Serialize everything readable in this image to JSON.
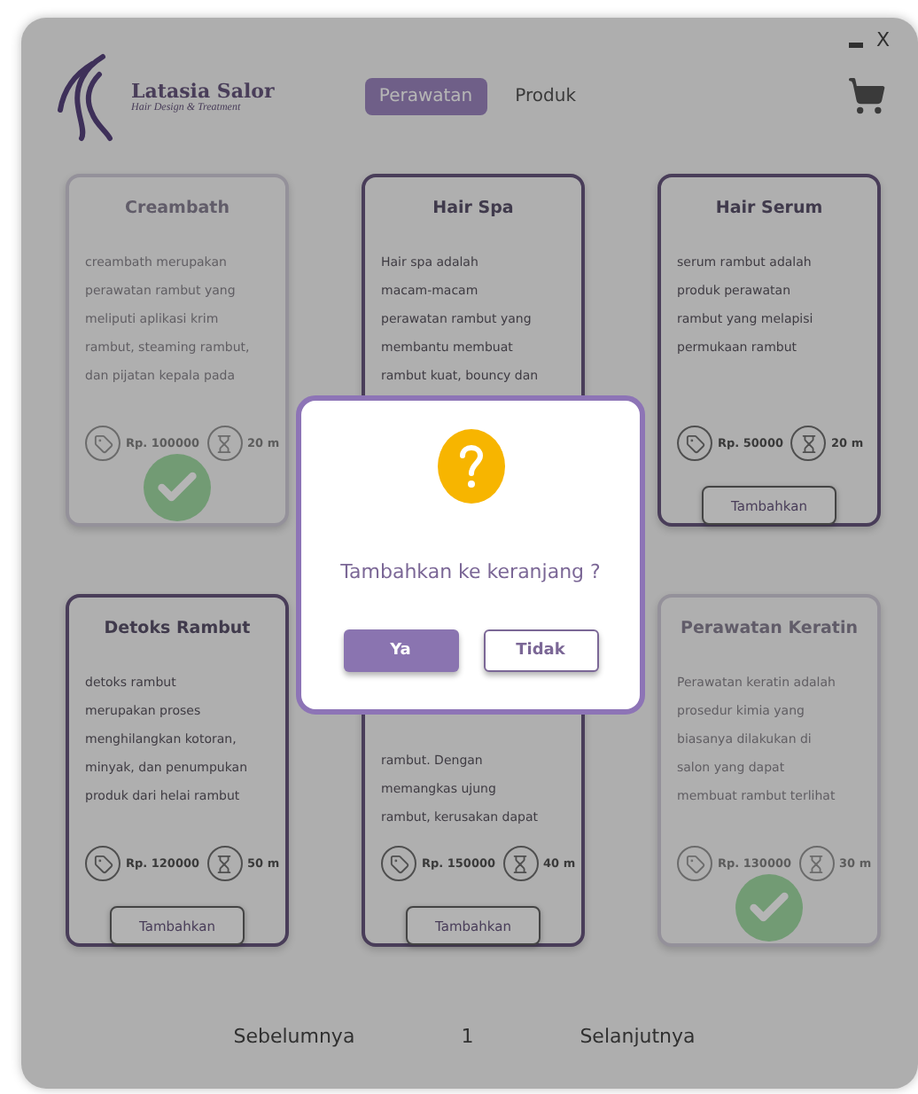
{
  "brand": {
    "name": "Latasia Salor",
    "tagline": "Hair Design & Treatment"
  },
  "tabs": [
    {
      "label": "Perawatan",
      "selected": true
    },
    {
      "label": "Produk",
      "selected": false
    }
  ],
  "window_controls": {
    "close": "X"
  },
  "cards": [
    {
      "title": "Creambath",
      "description": "creambath merupakan\nperawatan rambut yang\nmeliputi aplikasi krim\nrambut, steaming rambut,\ndan pijatan kepala pada",
      "price": "Rp. 100000",
      "duration": "20 m",
      "added": true
    },
    {
      "title": "Hair Spa",
      "description": "Hair spa adalah\nmacam-macam\nperawatan rambut yang\nmembantu membuat\nrambut kuat, bouncy dan",
      "added": false
    },
    {
      "title": "Hair Serum",
      "description": "serum rambut adalah\nproduk perawatan\nrambut yang melapisi\npermukaan rambut",
      "price": "Rp. 50000",
      "duration": "20 m",
      "button": "Tambahkan",
      "added": false
    },
    {
      "title": "Detoks Rambut",
      "description": "detoks rambut\nmerupakan proses\nmenghilangkan kotoran,\nminyak, dan penumpukan\nproduk dari helai rambut",
      "price": "Rp. 120000",
      "duration": "50 m",
      "button": "Tambahkan",
      "added": false
    },
    {
      "description": "rambut. Dengan\nmemangkas ujung\nrambut, kerusakan dapat",
      "price": "Rp. 150000",
      "duration": "40 m",
      "button": "Tambahkan",
      "added": false
    },
    {
      "title": "Perawatan Keratin",
      "description": "Perawatan keratin adalah\nprosedur kimia yang\nbiasanya dilakukan di\nsalon yang dapat\nmembuat rambut terlihat",
      "price": "Rp. 130000",
      "duration": "30 m",
      "added": true
    }
  ],
  "dialog": {
    "message": "Tambahkan ke keranjang ?",
    "buttons": [
      {
        "label": "Ya",
        "kind": "primary"
      },
      {
        "label": "Tidak",
        "kind": "secondary"
      }
    ]
  },
  "pagination": {
    "previous": "Sebelumnya",
    "page": "1",
    "next": "Selanjutnya"
  }
}
